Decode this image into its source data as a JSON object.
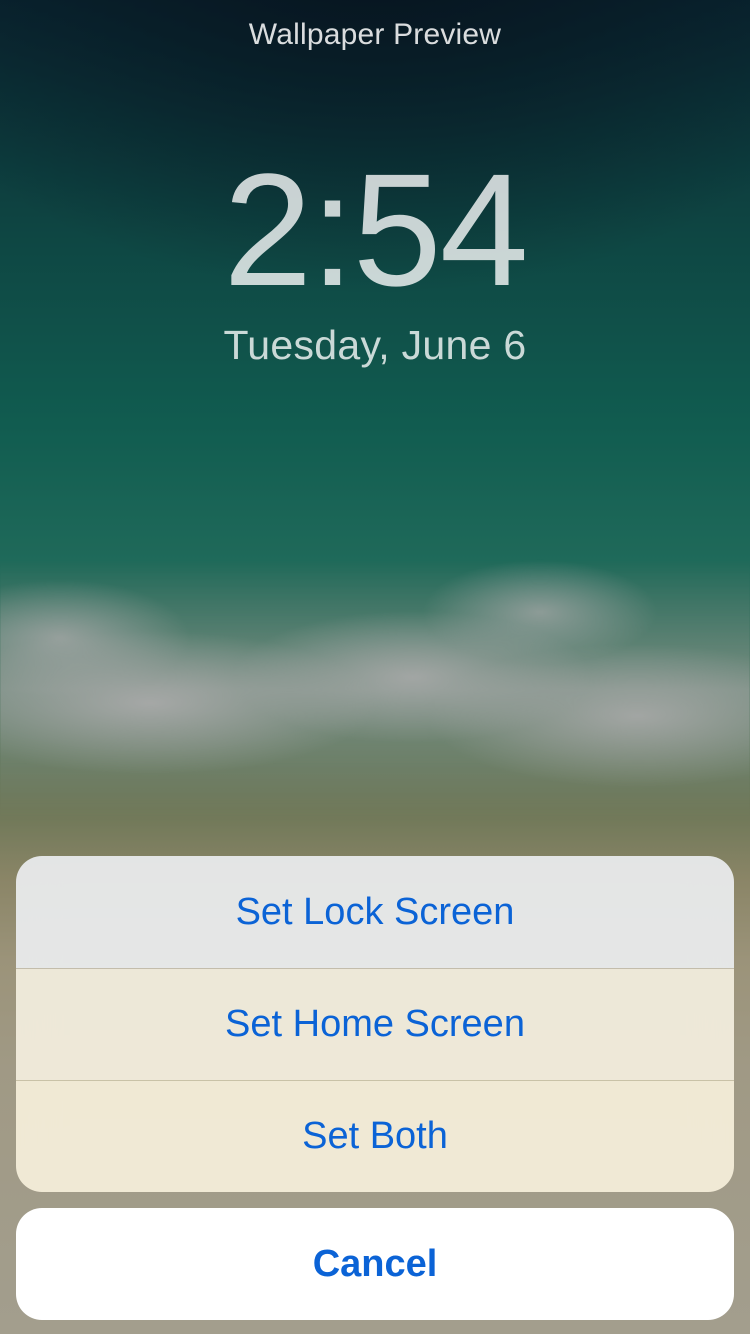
{
  "header": {
    "title": "Wallpaper Preview"
  },
  "lock": {
    "time": "2:54",
    "date": "Tuesday, June 6"
  },
  "sheet": {
    "options": [
      {
        "label": "Set Lock Screen"
      },
      {
        "label": "Set Home Screen"
      },
      {
        "label": "Set Both"
      }
    ],
    "cancel": "Cancel"
  }
}
